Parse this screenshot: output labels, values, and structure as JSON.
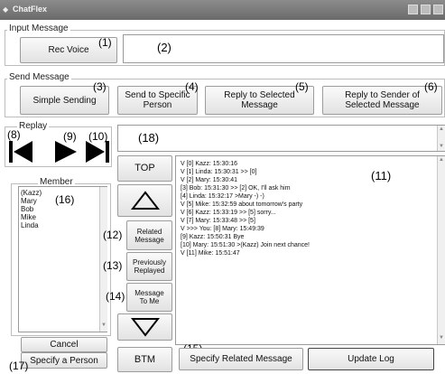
{
  "window": {
    "title": "ChatFlex"
  },
  "input_message": {
    "label": "Input Message",
    "rec_voice": "Rec Voice",
    "n_rec": "(1)",
    "n_field": "(2)"
  },
  "send_message": {
    "label": "Send Message",
    "simple": "Simple Sending",
    "specific_l1": "Send to Specific",
    "specific_l2": "Person",
    "reply_sel_l1": "Reply to Selected",
    "reply_sel_l2": "Message",
    "reply_sender_l1": "Reply to Sender of",
    "reply_sender_l2": "Selected Message",
    "n3": "(3)",
    "n4": "(4)",
    "n5": "(5)",
    "n6": "(6)"
  },
  "replay": {
    "label": "Replay",
    "n8": "(8)",
    "n9": "(9)",
    "n10": "(10)",
    "n18": "(18)"
  },
  "member": {
    "label": "Member",
    "names": [
      "(Kazz)",
      "Mary",
      "Bob",
      "Mike",
      "Linda"
    ],
    "n16": "(16)",
    "cancel": "Cancel",
    "specify": "Specify a Person",
    "n17": "(17)"
  },
  "nav": {
    "top": "TOP",
    "btm": "BTM",
    "related_l1": "Related",
    "related_l2": "Message",
    "prev_l1": "Previously",
    "prev_l2": "Replayed",
    "tome_l1": "Message",
    "tome_l2": "To Me",
    "n12": "(12)",
    "n13": "(13)",
    "n14": "(14)"
  },
  "log": {
    "n11": "(11)",
    "lines": [
      "V [0] Kazz: 15:30:16",
      "V [1] Linda: 15:30:31 >> [0]",
      "V [2] Mary: 15:30:41",
      "   [3] Bob: 15:31:30 >> [2] OK, I'll ask him",
      "   [4] Linda: 15:32:17 >Mary -) -)",
      "V [5] Mike: 15:32:59 about tomorrow's party",
      "V [6] Kazz: 15:33:19 >> [5] sorry...",
      "V [7] Mary: 15:33:48 >> [5]",
      "V >>> You: [8] Mary: 15:49:39",
      "   [9] Kazz: 15:50:31 Bye",
      "   [10] Mary: 15:51:30 >(Kazz) Join next chance!",
      "V [11] Mike: 15:51:47"
    ]
  },
  "bottom": {
    "specify_related": "Specify Related Message",
    "update_log": "Update Log",
    "n15": "(15)"
  }
}
